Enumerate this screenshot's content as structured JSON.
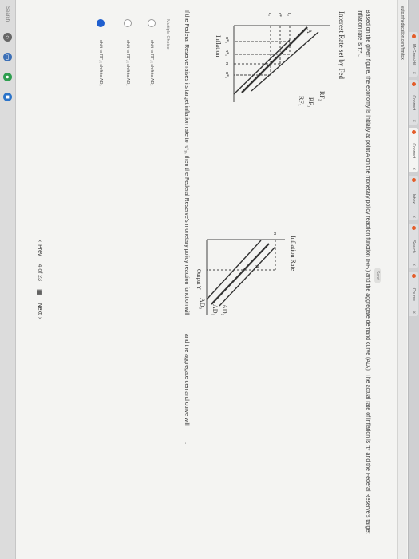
{
  "browser": {
    "tabs": [
      {
        "label": "McGraw-Hill",
        "active": false
      },
      {
        "label": "Connect",
        "active": false
      },
      {
        "label": "Connect",
        "active": true
      },
      {
        "label": "Inbox",
        "active": false
      },
      {
        "label": "Search",
        "active": false
      },
      {
        "label": "Course",
        "active": false
      }
    ],
    "url": "ezto.mheducation.com/hm.tpx"
  },
  "send_badge": "Send",
  "question": {
    "intro": "Based on the given figure, the economy is initially at point A on the monetary policy reaction function (RF₁) and the aggregate demand curve (AD₁). The actual rate of inflation is π* and the Federal Reserve's target inflation rate is π*₁.",
    "prompt": "If the Federal Reserve raises its target inflation rate to π*₃, then the Federal Reserve's monetary policy reaction function will _____ and the aggregate demand curve will _____."
  },
  "graph_left": {
    "title": "Interest Rate set by Fed",
    "xlabel": "Inflation",
    "curves": [
      "RF₂",
      "RF₁",
      "RF₃"
    ],
    "point": "A",
    "y_ticks": [
      "r₂",
      "r*",
      "r₁"
    ],
    "x_ticks": [
      "π*₂",
      "π*₁",
      "π",
      "π*₃"
    ]
  },
  "graph_right": {
    "title": "Inflation Rate",
    "xlabel": "Output  Y",
    "curves": [
      "AD₂",
      "AD₁",
      "AD₃"
    ],
    "point": "A",
    "y_tick": "π"
  },
  "multiple_choice": {
    "label": "Multiple Choice",
    "options": [
      {
        "text": "shift to RF₃; shift to AD₂",
        "selected": false
      },
      {
        "text": "shift to RF₂; shift to AD₂",
        "selected": false
      },
      {
        "text": "shift to RF₃; shift to AD₃",
        "selected": true
      }
    ]
  },
  "navigation": {
    "prev": "Prev",
    "current": "4",
    "of": "of",
    "total": "23",
    "next": "Next"
  },
  "taskbar": {
    "search": "Search"
  }
}
